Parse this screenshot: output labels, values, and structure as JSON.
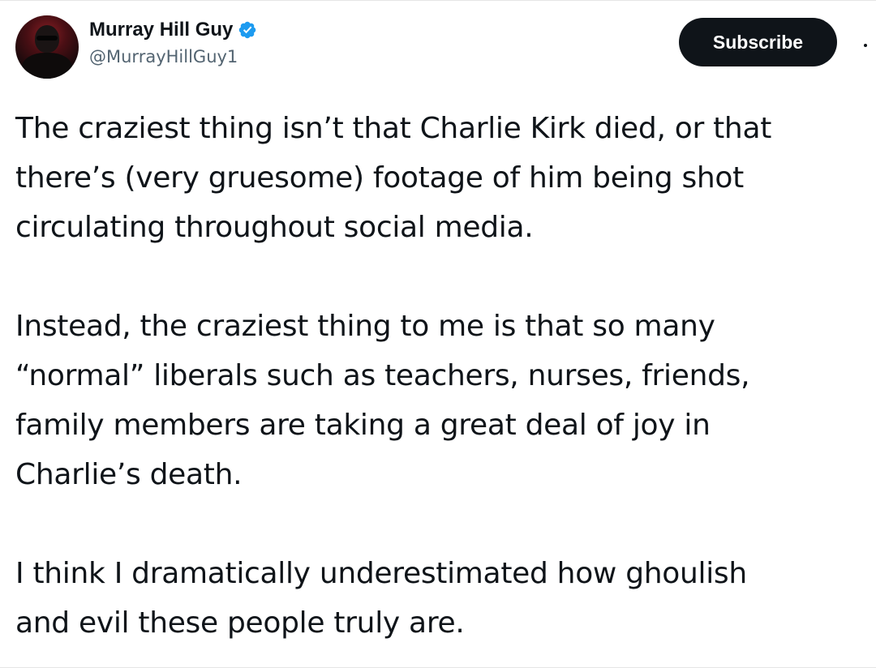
{
  "tweet": {
    "author": {
      "display_name": "Murray Hill Guy",
      "handle": "@MurrayHillGuy1",
      "verified": true
    },
    "subscribe_label": "Subscribe",
    "paragraphs": [
      [
        "The craziest thing isn’t that Charlie Kirk died, or that",
        "there’s (very gruesome) footage of him being shot",
        "circulating throughout social media."
      ],
      [
        "Instead, the craziest thing to me is that so many",
        "“normal” liberals such as teachers, nurses, friends,",
        "family members are taking a great deal of joy in",
        "Charlie’s death."
      ],
      [
        "I think I dramatically underestimated how ghoulish",
        "and evil these people truly are."
      ]
    ]
  },
  "icons": {
    "verified": "verified-badge-icon",
    "more": "more-options-icon"
  },
  "colors": {
    "verified_blue": "#1d9bf0",
    "button_bg": "#0f1419",
    "handle_gray": "#536471",
    "text": "#0f1419"
  }
}
